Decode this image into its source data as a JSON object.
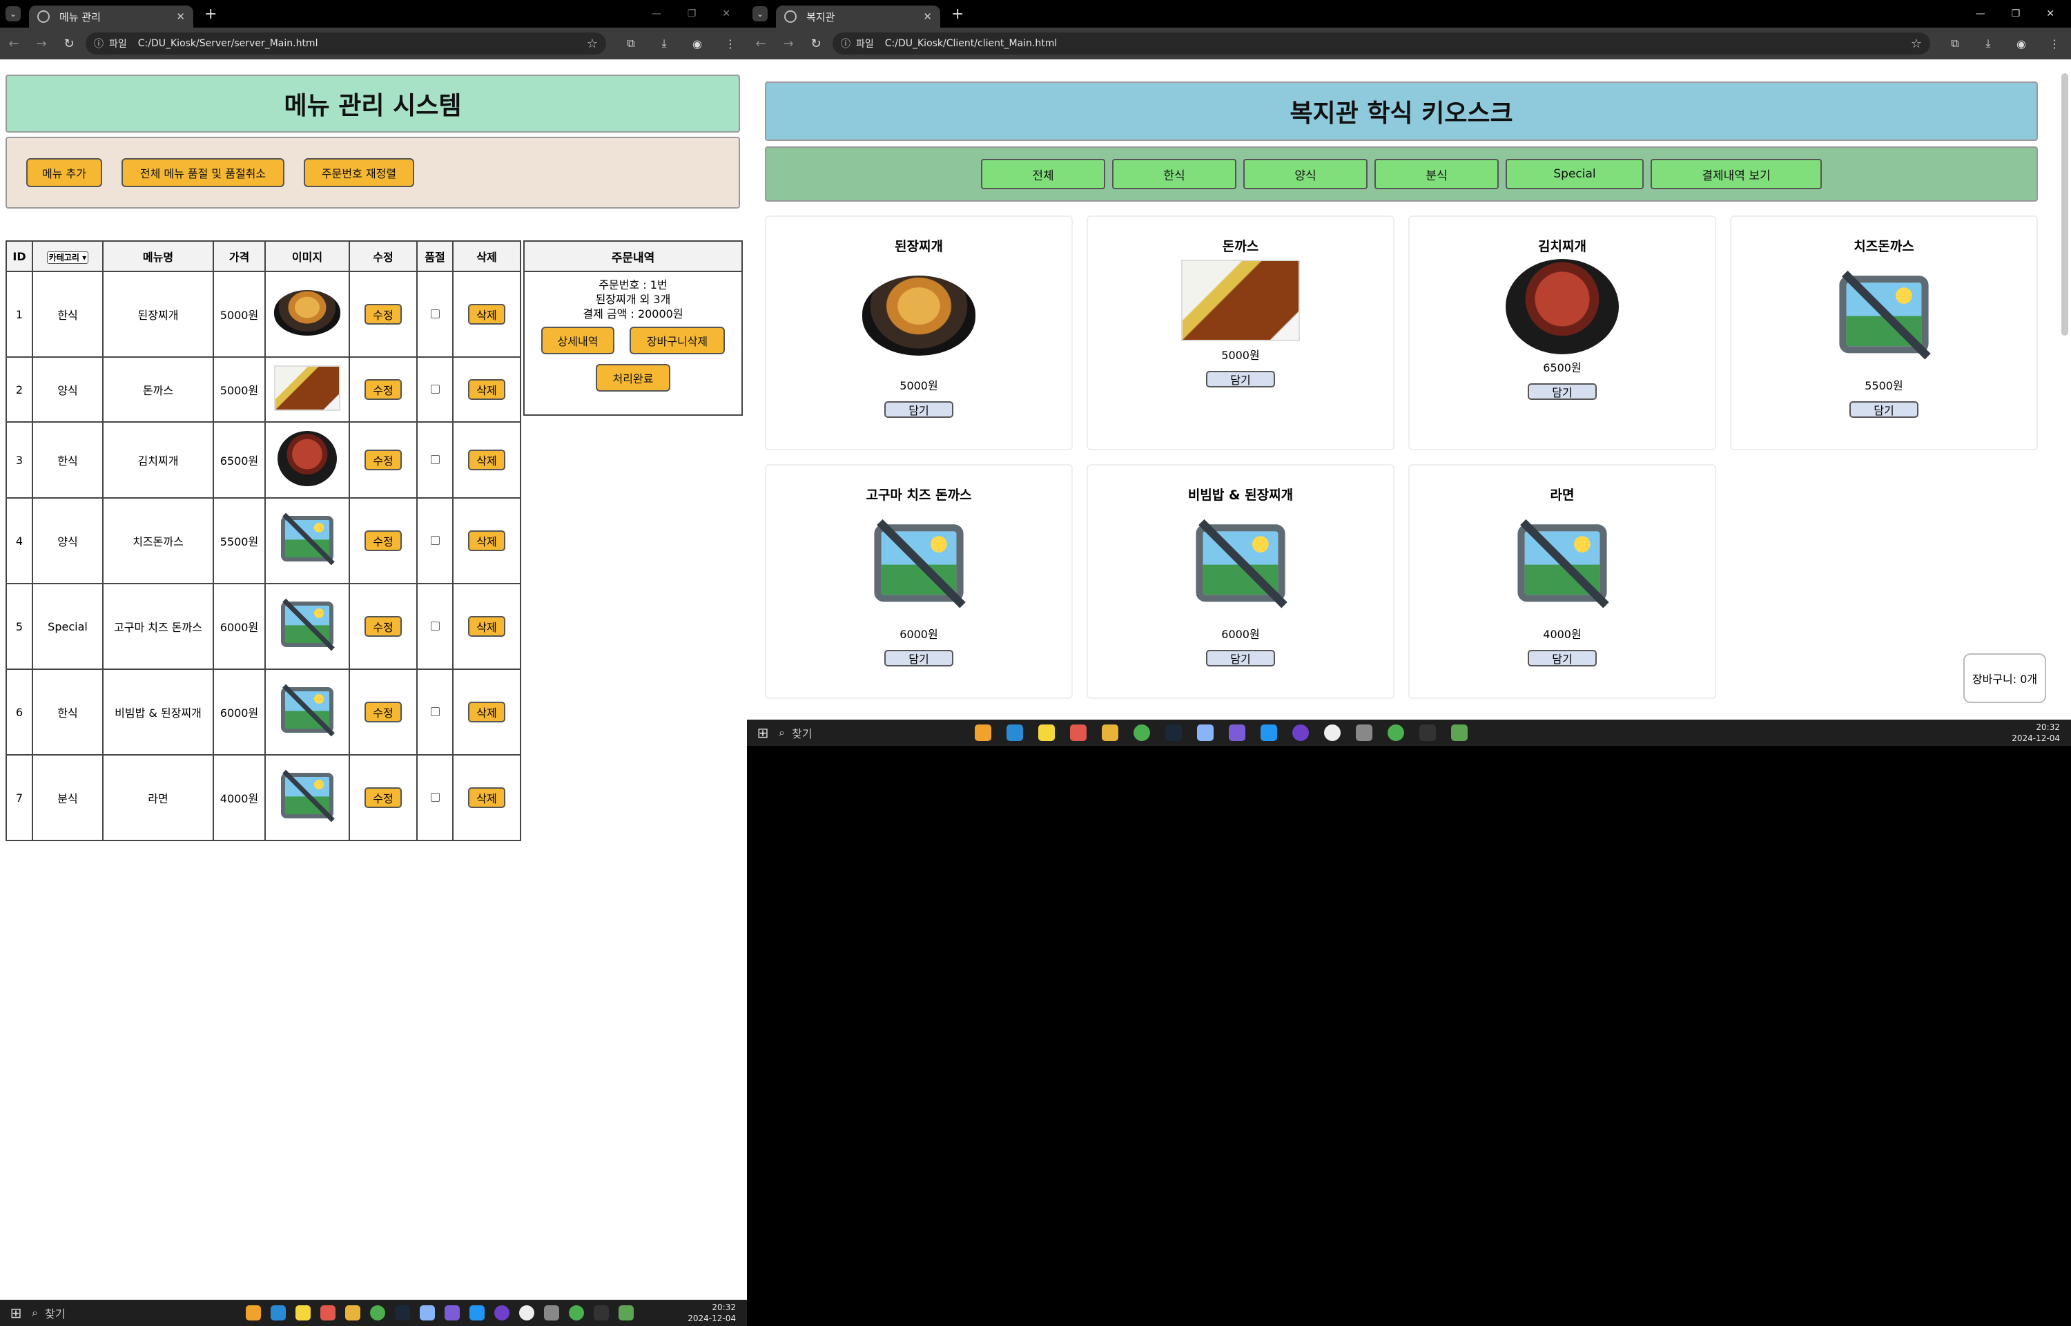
{
  "left_window": {
    "tab_title": "메뉴 관리",
    "url_scheme": "파일",
    "url": "C:/DU_Kiosk/Server/server_Main.html",
    "page_title": "메뉴 관리 시스템",
    "controls": {
      "add_menu": "메뉴 추가",
      "soldout_all": "전체 메뉴 품절 및 품절취소",
      "reset_order": "주문번호 재정렬"
    },
    "table": {
      "headers": {
        "id": "ID",
        "category": "카테고리",
        "name": "메뉴명",
        "price": "가격",
        "image": "이미지",
        "edit": "수정",
        "soldout": "품절",
        "delete": "삭제"
      },
      "edit_label": "수정",
      "delete_label": "삭제",
      "rows": [
        {
          "id": "1",
          "category": "한식",
          "name": "된장찌개",
          "price": "5000원",
          "image": "doenjang-jjigae"
        },
        {
          "id": "2",
          "category": "양식",
          "name": "돈까스",
          "price": "5000원",
          "image": "tonkatsu"
        },
        {
          "id": "3",
          "category": "한식",
          "name": "김치찌개",
          "price": "6500원",
          "image": "kimchi-jjigae"
        },
        {
          "id": "4",
          "category": "양식",
          "name": "치즈돈까스",
          "price": "5500원",
          "image": "broken-image"
        },
        {
          "id": "5",
          "category": "Special",
          "name": "고구마 치즈 돈까스",
          "price": "6000원",
          "image": "broken-image"
        },
        {
          "id": "6",
          "category": "한식",
          "name": "비빔밥 & 된장찌개",
          "price": "6000원",
          "image": "broken-image"
        },
        {
          "id": "7",
          "category": "분식",
          "name": "라면",
          "price": "4000원",
          "image": "broken-image"
        }
      ]
    },
    "orders": {
      "title": "주문내역",
      "order_no": "주문번호 : 1번",
      "summary": "된장찌개 외 3개",
      "total": "결제 금액 : 20000원",
      "detail_btn": "상세내역",
      "delete_btn": "장바구니삭제",
      "done_btn": "처리완료"
    },
    "taskbar": {
      "search": "찾기",
      "time": "20:32",
      "date": "2024-12-04"
    }
  },
  "right_window": {
    "tab_title": "복지관",
    "url_scheme": "파일",
    "url": "C:/DU_Kiosk/Client/client_Main.html",
    "page_title": "복지관 학식 키오스크",
    "categories": [
      "전체",
      "한식",
      "양식",
      "분식",
      "Special",
      "결제내역 보기"
    ],
    "add_label": "담기",
    "items": [
      {
        "name": "된장찌개",
        "price": "5000원",
        "image": "doenjang-jjigae"
      },
      {
        "name": "돈까스",
        "price": "5000원",
        "image": "tonkatsu"
      },
      {
        "name": "김치찌개",
        "price": "6500원",
        "image": "kimchi-jjigae"
      },
      {
        "name": "치즈돈까스",
        "price": "5500원",
        "image": "broken-image"
      },
      {
        "name": "고구마 치즈 돈까스",
        "price": "6000원",
        "image": "broken-image"
      },
      {
        "name": "비빔밥 & 된장찌개",
        "price": "6000원",
        "image": "broken-image"
      },
      {
        "name": "라면",
        "price": "4000원",
        "image": "broken-image"
      }
    ],
    "cart": "장바구니: 0개",
    "taskbar": {
      "search": "찾기",
      "time": "20:32",
      "date": "2024-12-04"
    }
  },
  "colors": {
    "left_header": "#a7e2c7",
    "right_header": "#8ec9dc",
    "orange_button": "#f6b833",
    "green_button": "#80de7b"
  }
}
